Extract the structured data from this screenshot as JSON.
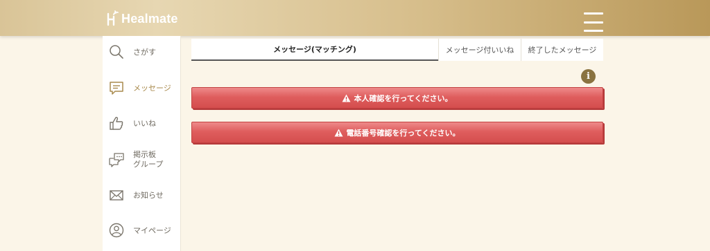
{
  "header": {
    "logo_text": "Healmate",
    "menu_icon": "hamburger-menu-icon"
  },
  "sidebar": {
    "items": [
      {
        "label": "さがす",
        "icon": "search-icon"
      },
      {
        "label": "メッセージ",
        "icon": "message-icon",
        "active": true
      },
      {
        "label": "いいね",
        "icon": "thumbs-up-icon"
      },
      {
        "label": "掲示板\nグループ",
        "label_line1": "掲示板",
        "label_line2": "グループ",
        "icon": "bulletin-board-icon"
      },
      {
        "label": "お知らせ",
        "icon": "mail-icon"
      },
      {
        "label": "マイページ",
        "icon": "user-icon"
      }
    ]
  },
  "tabs": [
    {
      "label": "メッセージ(マッチング)",
      "active": true
    },
    {
      "label": "メッセージ付いいね",
      "active": false
    },
    {
      "label": "終了したメッセージ",
      "active": false
    }
  ],
  "alerts": [
    {
      "label": "本人確認を行ってください。",
      "icon": "warning-icon"
    },
    {
      "label": "電話番号確認を行ってください。",
      "icon": "warning-icon"
    }
  ],
  "info_icon": "info-icon",
  "colors": {
    "accent": "#a98a4d",
    "alert": "#d44d4d",
    "background": "#fbf5e8"
  }
}
